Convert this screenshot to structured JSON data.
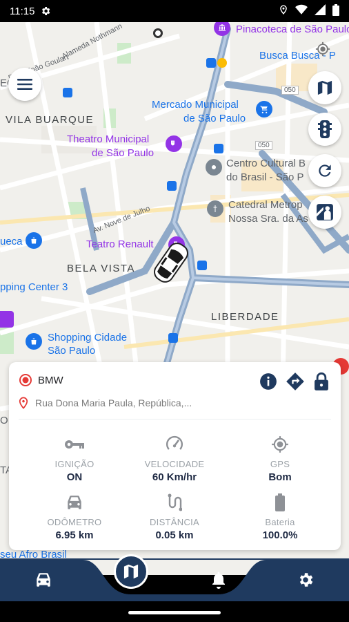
{
  "status_bar": {
    "time": "11:15"
  },
  "map": {
    "labels": {
      "vila_buarque": "VILA BUARQUE",
      "bela_vista": "BELA VISTA",
      "liberdade": "LIBERDADE",
      "pinacoteca": "Pinacoteca de São Paulo",
      "busca_busca": "Busca Busca - P",
      "mercado_1": "Mercado Municipal",
      "mercado_2": "de São Paulo",
      "teatro_municipal_1": "Theatro Municipal",
      "teatro_municipal_2": "de São Paulo",
      "centro_cultural_1": "Centro Cultural B",
      "centro_cultural_2": "do Brasil - São P",
      "catedral_1": "Catedral Metrop",
      "catedral_2": "Nossa Sra. da As",
      "teatro_renault": "Teatro Renault",
      "shopping_center": "pping Center 3",
      "shopping_cidade_1": "Shopping Cidade",
      "shopping_cidade_2": "São Paulo",
      "ueca": "ueca",
      "museu": "seu Afro Brasil",
      "alameda": "Alameda Nothmann",
      "joao_goulart": "Pres. João Goulart",
      "nove_de_julho": "Av. Nove de Julho",
      "route_050_a": "050",
      "route_050_b": "050",
      "map_letter_ec": "EC",
      "map_letter_ta": "TA",
      "map_letter_o": "O"
    }
  },
  "vehicle": {
    "name": "BMW",
    "address": "Rua Dona Maria Paula, República,...",
    "metrics": [
      {
        "icon": "key-icon",
        "label": "IGNIÇÃO",
        "value": "ON"
      },
      {
        "icon": "speedometer-icon",
        "label": "VELOCIDADE",
        "value": "60 Km/hr"
      },
      {
        "icon": "gps-icon",
        "label": "GPS",
        "value": "Bom"
      },
      {
        "icon": "car-icon",
        "label": "ODÔMETRO",
        "value": "6.95 km"
      },
      {
        "icon": "route-icon",
        "label": "DISTÂNCIA",
        "value": "0.05 km"
      },
      {
        "icon": "battery-icon",
        "label": "Bateria",
        "value": "100.0%"
      }
    ]
  },
  "colors": {
    "navy": "#1f3a5f",
    "accent_red": "#e53935",
    "poi_blue": "#1a73e8",
    "poi_purple": "#9334e6"
  },
  "bottom_nav": {
    "items": [
      "car-icon",
      "map-icon",
      "bell-icon",
      "settings-icon"
    ],
    "active": "map-icon"
  }
}
